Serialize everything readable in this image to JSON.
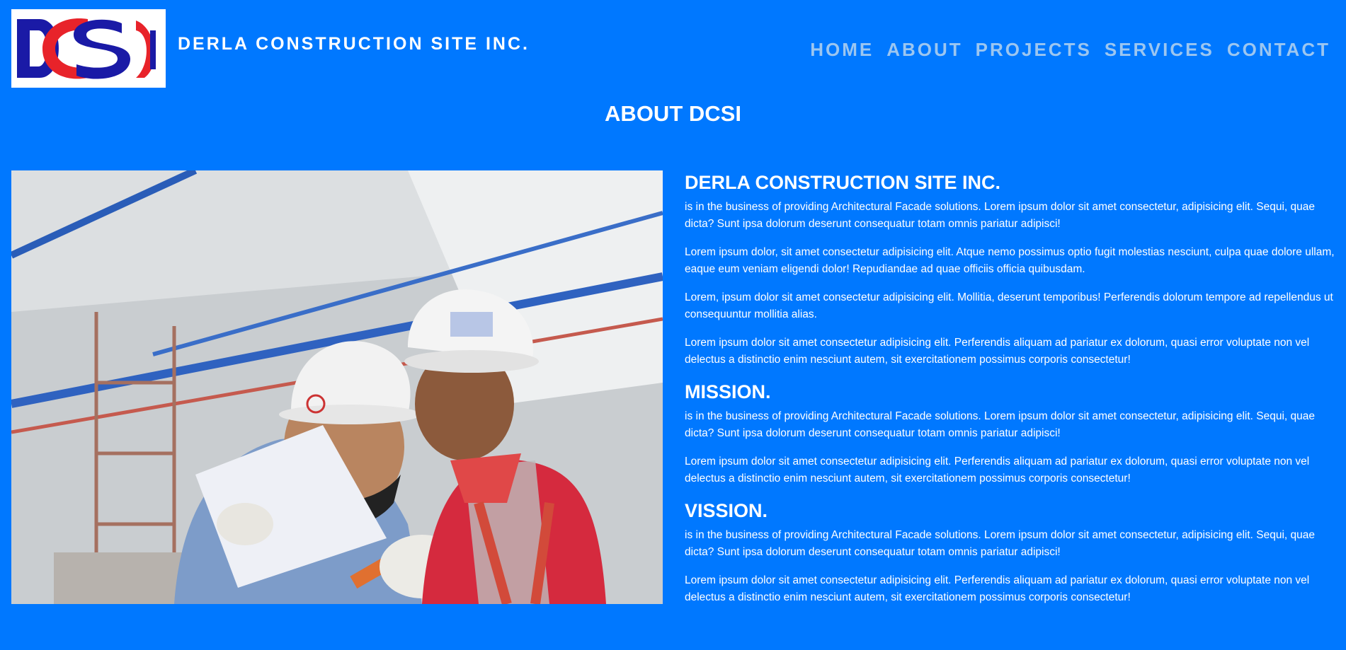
{
  "header": {
    "logo_text": "DCSI",
    "brand": "DERLA CONSTRUCTION SITE INC."
  },
  "nav": {
    "items": [
      "HOME",
      "ABOUT",
      "PROJECTS",
      "SERVICES",
      "CONTACT"
    ]
  },
  "section": {
    "title": "ABOUT DCSI"
  },
  "about": {
    "heading": "DERLA CONSTRUCTION SITE INC.",
    "paragraphs": [
      "is in the business of providing Architectural Facade solutions. Lorem ipsum dolor sit amet consectetur, adipisicing elit. Sequi, quae dicta? Sunt ipsa dolorum deserunt consequatur totam omnis pariatur adipisci!",
      "Lorem ipsum dolor, sit amet consectetur adipisicing elit. Atque nemo possimus optio fugit molestias nesciunt, culpa quae dolore ullam, eaque eum veniam eligendi dolor! Repudiandae ad quae officiis officia quibusdam.",
      "Lorem, ipsum dolor sit amet consectetur adipisicing elit. Mollitia, deserunt temporibus! Perferendis dolorum tempore ad repellendus ut consequuntur mollitia alias.",
      "Lorem ipsum dolor sit amet consectetur adipisicing elit. Perferendis aliquam ad pariatur ex dolorum, quasi error voluptate non vel delectus a distinctio enim nesciunt autem, sit exercitationem possimus corporis consectetur!"
    ]
  },
  "mission": {
    "heading": "MISSION.",
    "paragraphs": [
      "is in the business of providing Architectural Facade solutions. Lorem ipsum dolor sit amet consectetur, adipisicing elit. Sequi, quae dicta? Sunt ipsa dolorum deserunt consequatur totam omnis pariatur adipisci!",
      "Lorem ipsum dolor sit amet consectetur adipisicing elit. Perferendis aliquam ad pariatur ex dolorum, quasi error voluptate non vel delectus a distinctio enim nesciunt autem, sit exercitationem possimus corporis consectetur!"
    ]
  },
  "vission": {
    "heading": "VISSION.",
    "paragraphs": [
      "is in the business of providing Architectural Facade solutions. Lorem ipsum dolor sit amet consectetur, adipisicing elit. Sequi, quae dicta? Sunt ipsa dolorum deserunt consequatur totam omnis pariatur adipisci!",
      "Lorem ipsum dolor sit amet consectetur adipisicing elit. Perferendis aliquam ad pariatur ex dolorum, quasi error voluptate non vel delectus a distinctio enim nesciunt autem, sit exercitationem possimus corporis consectetur!"
    ]
  },
  "colors": {
    "background": "#0078FF",
    "nav_text": "#9cc6f0",
    "logo_blue": "#1a1aa6",
    "logo_red": "#e8232a"
  },
  "image": {
    "icon": "construction-workers-photo"
  }
}
